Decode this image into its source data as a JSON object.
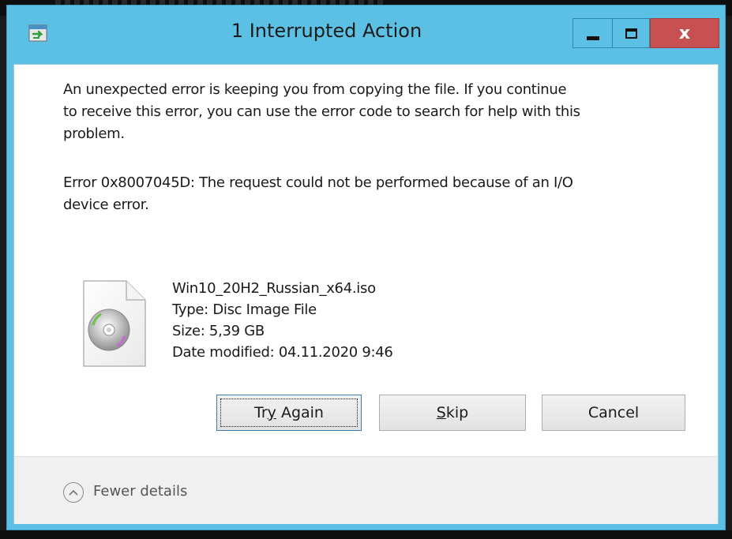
{
  "window": {
    "title": "1 Interrupted Action",
    "minimize_glyph": "",
    "maximize_glyph": "",
    "close_glyph": "x"
  },
  "message": {
    "line1": "An unexpected error is keeping you from copying the file. If you continue",
    "line2": "to receive this error, you can use the error code to search for help with this",
    "line3": "problem.",
    "error_line1": "Error 0x8007045D: The request could not be performed because of an I/O",
    "error_line2": "device error."
  },
  "file": {
    "icon": "disc-image-file-icon",
    "name": "Win10_20H2_Russian_x64.iso",
    "type": "Type: Disc Image File",
    "size": "Size: 5,39 GB",
    "date_modified": "Date modified: 04.11.2020 9:46"
  },
  "buttons": {
    "try_again_pre": "Tr",
    "try_again_mnemonic": "y",
    "try_again_post": " Again",
    "skip_mnemonic": "S",
    "skip_post": "kip",
    "cancel": "Cancel"
  },
  "footer": {
    "toggle_icon": "chevron-up-circle-icon",
    "fewer_details": "Fewer details"
  },
  "colors": {
    "titlebar": "#5bc0e3",
    "close_button": "#c75050",
    "footer_bg": "#f0f0f0"
  }
}
